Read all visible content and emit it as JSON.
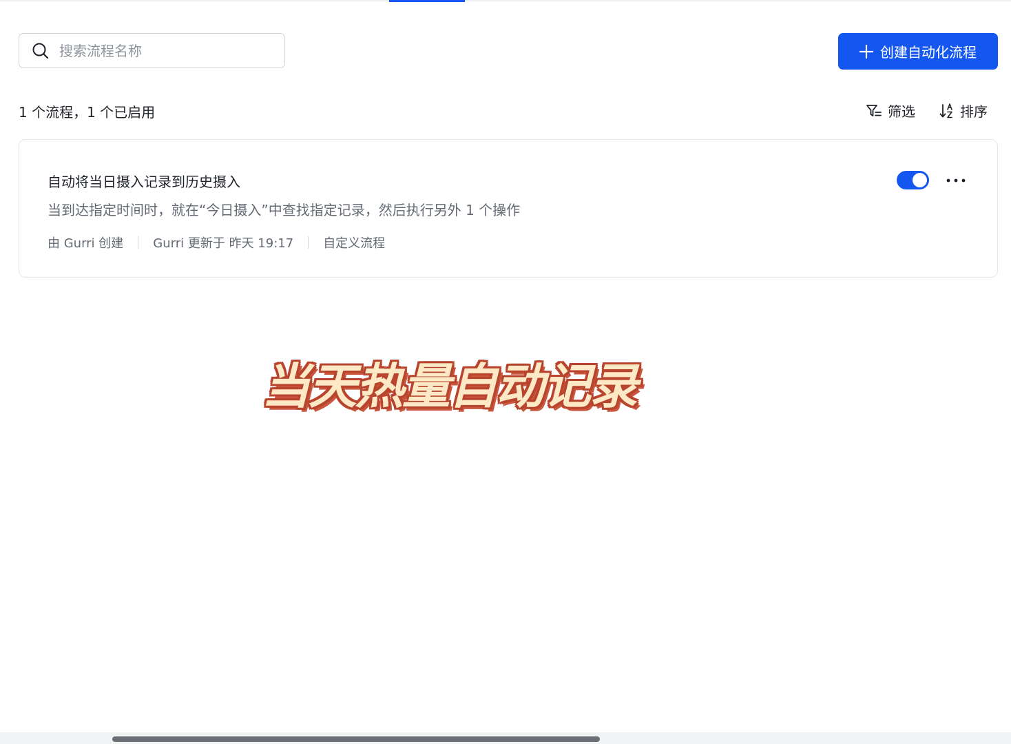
{
  "search": {
    "placeholder": "搜索流程名称",
    "value": ""
  },
  "header": {
    "create_button_label": "创建自动化流程"
  },
  "toolbar": {
    "summary": "1 个流程，1 个已启用",
    "filter_label": "筛选",
    "sort_label": "排序"
  },
  "flows": [
    {
      "title": "自动将当日摄入记录到历史摄入",
      "description": "当到达指定时间时，就在“今日摄入”中查找指定记录，然后执行另外 1 个操作",
      "meta": {
        "creator": "由 Gurri 创建",
        "updated": "Gurri 更新于 昨天 19:17",
        "type": "自定义流程"
      },
      "enabled": true
    }
  ],
  "overlay": {
    "caption": "当天热量自动记录"
  },
  "colors": {
    "accent": "#1456f0",
    "caption_fill": "#fde9c6",
    "caption_outline": "#b8442e"
  },
  "icons": {
    "search": "search-icon",
    "create": "plus-icon",
    "filter": "filter-icon",
    "sort": "sort-icon",
    "more": "more-icon"
  }
}
